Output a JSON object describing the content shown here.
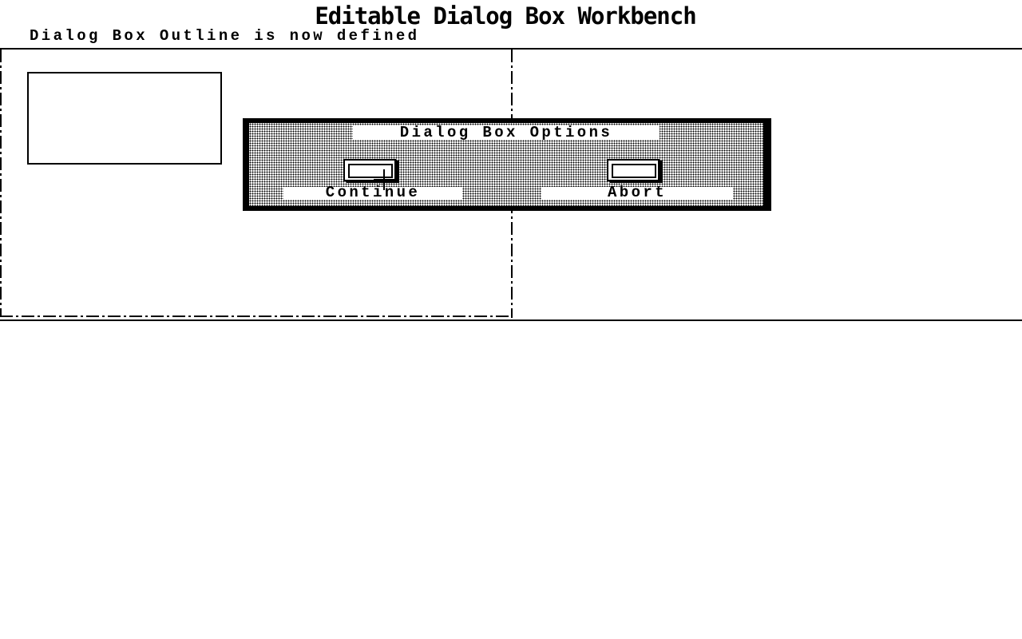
{
  "app": {
    "title": "Editable Dialog Box Workbench"
  },
  "status": {
    "message": "Dialog Box Outline is now defined"
  },
  "dialog": {
    "title": "Dialog Box Options",
    "buttons": {
      "continue_label": "Continue",
      "abort_label": "Abort"
    }
  },
  "icons": {
    "cursor": "crosshair-cursor-icon"
  },
  "colors": {
    "foreground": "#000000",
    "background": "#ffffff"
  }
}
